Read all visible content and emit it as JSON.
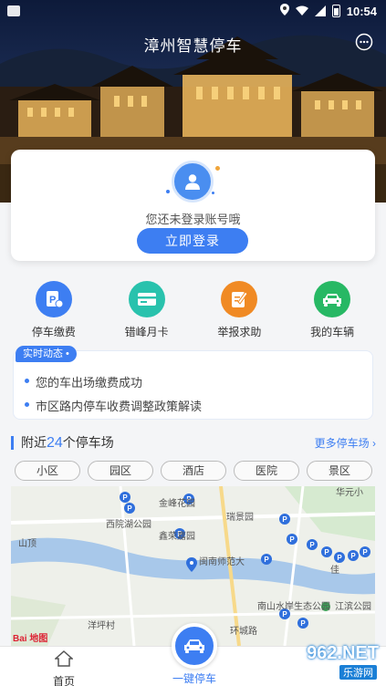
{
  "status_bar": {
    "time": "10:54"
  },
  "header": {
    "title": "漳州智慧停车"
  },
  "login": {
    "hint": "您还未登录账号哦",
    "button_label": "立即登录"
  },
  "quick_actions": [
    {
      "label": "停车缴费",
      "icon": "parking-pay-icon",
      "color": "#3d7ef2"
    },
    {
      "label": "错峰月卡",
      "icon": "card-icon",
      "color": "#29c2ad"
    },
    {
      "label": "举报求助",
      "icon": "report-icon",
      "color": "#f08a24"
    },
    {
      "label": "我的车辆",
      "icon": "car-icon",
      "color": "#27b864"
    }
  ],
  "news": {
    "tag": "实时动态",
    "items": [
      "您的车出场缴费成功",
      "市区路内停车收费调整政策解读"
    ]
  },
  "nearby": {
    "prefix": "附近",
    "count": "24",
    "suffix": "个停车场",
    "more_label": "更多停车场",
    "filters": [
      "小区",
      "园区",
      "酒店",
      "医院",
      "景区"
    ]
  },
  "map": {
    "labels": [
      "金峰花园",
      "西院湖公园",
      "瑞景园",
      "鑫荣嘉园",
      "闽南师范大",
      "山顶",
      "佳",
      "南山水岸生态公园",
      "江滨公园",
      "洋坪村",
      "华元小",
      "环城路"
    ],
    "logo_text": "Bai 地图"
  },
  "bottom_nav": {
    "home_label": "首页",
    "park_label": "一键停车"
  },
  "watermark": {
    "text": "962.NET",
    "sub": "乐游网"
  }
}
